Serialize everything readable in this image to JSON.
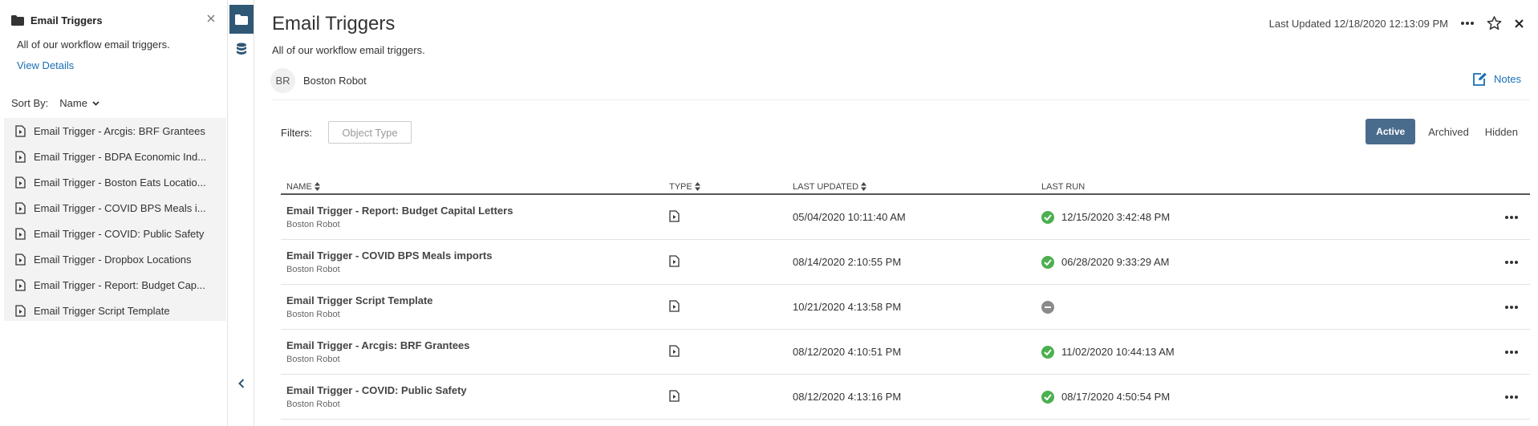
{
  "sidebar": {
    "title": "Email Triggers",
    "description": "All of our workflow email triggers.",
    "view_details": "View Details",
    "sort_label": "Sort By:",
    "sort_value": "Name",
    "items": [
      {
        "label": "Email Trigger - Arcgis: BRF Grantees"
      },
      {
        "label": "Email Trigger - BDPA Economic Ind..."
      },
      {
        "label": "Email Trigger - Boston Eats Locatio..."
      },
      {
        "label": "Email Trigger - COVID BPS Meals i..."
      },
      {
        "label": "Email Trigger - COVID: Public Safety"
      },
      {
        "label": "Email Trigger - Dropbox Locations"
      },
      {
        "label": "Email Trigger - Report: Budget Cap..."
      },
      {
        "label": "Email Trigger Script Template"
      }
    ]
  },
  "header": {
    "title": "Email Triggers",
    "description": "All of our workflow email triggers.",
    "owner_initials": "BR",
    "owner_name": "Boston Robot",
    "last_updated": "Last Updated 12/18/2020 12:13:09 PM",
    "notes_label": "Notes"
  },
  "filters": {
    "label": "Filters:",
    "object_type_placeholder": "Object Type"
  },
  "tabs": {
    "active": "Active",
    "archived": "Archived",
    "hidden": "Hidden"
  },
  "table": {
    "columns": {
      "name": "Name",
      "type": "Type",
      "last_updated": "Last Updated",
      "last_run": "Last Run"
    },
    "rows": [
      {
        "name": "Email Trigger - Report: Budget Capital Letters",
        "owner": "Boston Robot",
        "updated": "05/04/2020 10:11:40 AM",
        "run": "12/15/2020 3:42:48 PM",
        "status": "ok"
      },
      {
        "name": "Email Trigger - COVID BPS Meals imports",
        "owner": "Boston Robot",
        "updated": "08/14/2020 2:10:55 PM",
        "run": "06/28/2020 9:33:29 AM",
        "status": "ok"
      },
      {
        "name": "Email Trigger Script Template",
        "owner": "Boston Robot",
        "updated": "10/21/2020 4:13:58 PM",
        "run": "",
        "status": "none"
      },
      {
        "name": "Email Trigger - Arcgis: BRF Grantees",
        "owner": "Boston Robot",
        "updated": "08/12/2020 4:10:51 PM",
        "run": "11/02/2020 10:44:13 AM",
        "status": "ok"
      },
      {
        "name": "Email Trigger - COVID: Public Safety",
        "owner": "Boston Robot",
        "updated": "08/12/2020 4:13:16 PM",
        "run": "08/17/2020 4:50:54 PM",
        "status": "ok"
      }
    ]
  },
  "colors": {
    "accent": "#2f5875",
    "link": "#1a6fb5",
    "success": "#4caf50",
    "neutral": "#8a8a8a"
  }
}
